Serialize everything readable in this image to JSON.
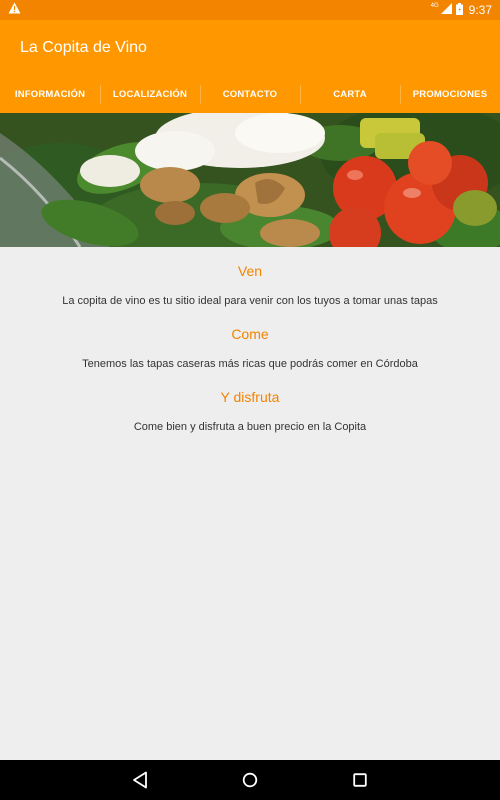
{
  "status_bar": {
    "time": "9:37",
    "network": "4G",
    "icons": [
      "warning-icon",
      "signal-icon",
      "battery-icon"
    ]
  },
  "app_bar": {
    "title": "La Copita de Vino"
  },
  "tabs": [
    {
      "label": "INFORMACIÓN"
    },
    {
      "label": "LOCALIZACIÓN"
    },
    {
      "label": "CONTACTO"
    },
    {
      "label": "CARTA"
    },
    {
      "label": "PROMOCIONES"
    }
  ],
  "sections": [
    {
      "title": "Ven",
      "text": "La copita de vino es tu sitio ideal para venir con los tuyos a tomar unas tapas"
    },
    {
      "title": "Come",
      "text": "Tenemos las tapas caseras más ricas que podrás comer en Córdoba"
    },
    {
      "title": "Y disfruta",
      "text": "Come bien y disfruta a buen precio en la Copita"
    }
  ],
  "nav_bar": {
    "icons": [
      "back-icon",
      "home-icon",
      "recents-icon"
    ]
  },
  "colors": {
    "status_bar": "#f28400",
    "app_bar": "#ff9800",
    "accent_text": "#f28400",
    "background": "#eeeeee"
  }
}
